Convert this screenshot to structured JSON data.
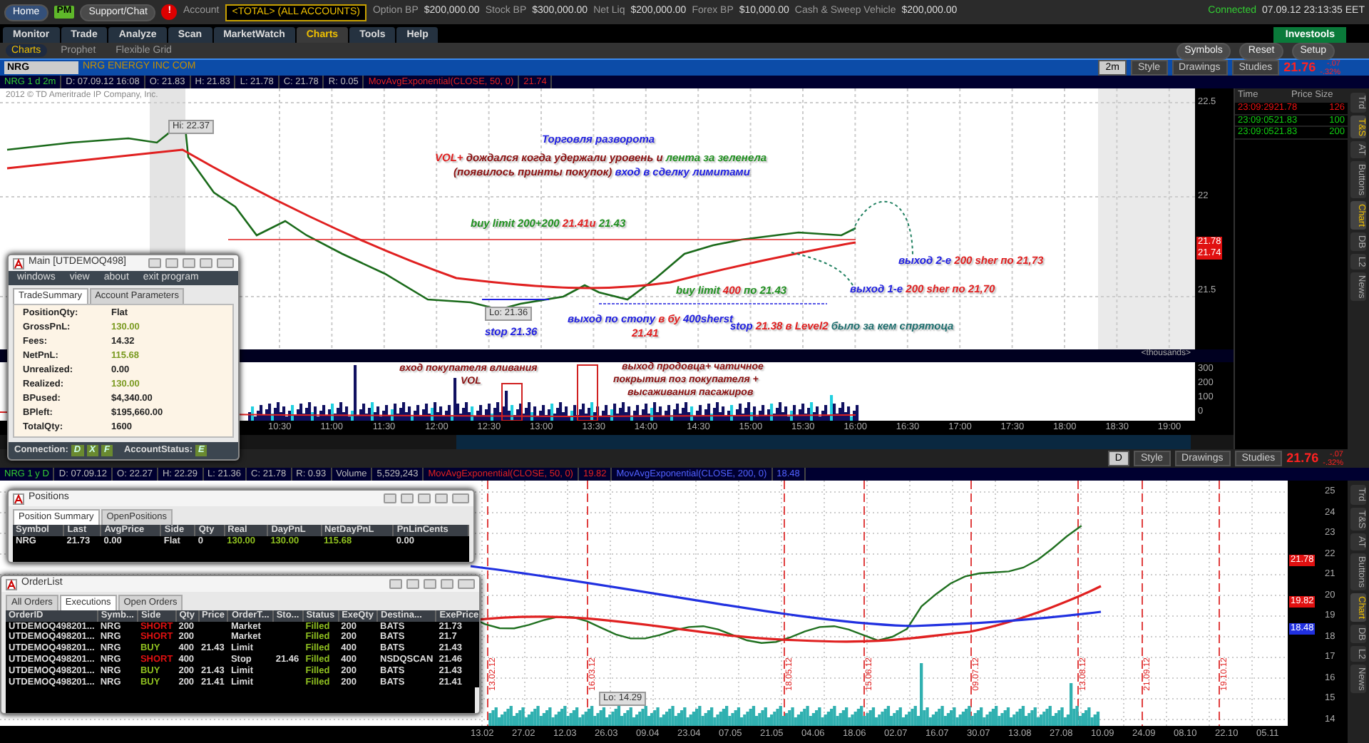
{
  "account_bar": {
    "home": "Home",
    "pm": "PM",
    "support": "Support/Chat",
    "alert": "!",
    "account_label": "Account",
    "account": "<TOTAL> (ALL ACCOUNTS)",
    "balances": [
      {
        "label": "Option BP",
        "value": "$200,000.00"
      },
      {
        "label": "Stock BP",
        "value": "$300,000.00"
      },
      {
        "label": "Net Liq",
        "value": "$200,000.00"
      },
      {
        "label": "Forex BP",
        "value": "$10,000.00"
      },
      {
        "label": "Cash & Sweep Vehicle",
        "value": "$200,000.00"
      }
    ],
    "status": "Connected",
    "datetime": "07.09.12 23:13:35 EET"
  },
  "main_tabs": [
    {
      "label": "Monitor",
      "selected": false
    },
    {
      "label": "Trade",
      "selected": false
    },
    {
      "label": "Analyze",
      "selected": false
    },
    {
      "label": "Scan",
      "selected": false
    },
    {
      "label": "MarketWatch",
      "selected": false
    },
    {
      "label": "Charts",
      "selected": true
    },
    {
      "label": "Tools",
      "selected": false
    },
    {
      "label": "Help",
      "selected": false
    }
  ],
  "investools": "Investools",
  "sub_tabs": [
    {
      "label": "Charts",
      "selected": true
    },
    {
      "label": "Prophet",
      "selected": false
    },
    {
      "label": "Flexible Grid",
      "selected": false
    }
  ],
  "toolbar_buttons": [
    "Symbols",
    "Reset",
    "Setup"
  ],
  "top_chart": {
    "symbol": "NRG",
    "company": "NRG ENERGY INC COM",
    "aggregation": "2m",
    "buttons": [
      "Style",
      "Drawings",
      "Studies"
    ],
    "last": "21.76",
    "change": "-.07",
    "change_pct": "-.32%",
    "info": [
      {
        "text": "NRG 1 d 2m",
        "kind": "title"
      },
      {
        "text": "D: 07.09.12 16:08",
        "kind": "plain"
      },
      {
        "text": "O: 21.83",
        "kind": "plain"
      },
      {
        "text": "H: 21.83",
        "kind": "plain"
      },
      {
        "text": "L: 21.78",
        "kind": "plain"
      },
      {
        "text": "C: 21.78",
        "kind": "plain"
      },
      {
        "text": "R: 0.05",
        "kind": "plain"
      },
      {
        "text": "MovAvgExponential(CLOSE, 50, 0)",
        "kind": "study"
      },
      {
        "text": "21.74",
        "kind": "study"
      }
    ],
    "copyright": "2012 © TD Ameritrade IP Company, Inc.",
    "high_label": "Hi: 22.37",
    "low_label": "Lo: 21.36",
    "price_axis": [
      "22.5",
      "22",
      "21.5"
    ],
    "price_tags": [
      "21.78",
      "21.74"
    ],
    "volume_unit": "<thousands>",
    "volume_axis": [
      "300",
      "200",
      "100",
      "0"
    ],
    "time_axis": [
      "10:30",
      "11:00",
      "11:30",
      "12:00",
      "12:30",
      "13:00",
      "13:30",
      "14:00",
      "14:30",
      "15:00",
      "15:30",
      "16:00",
      "16:30",
      "17:00",
      "17:30",
      "18:00",
      "18:30",
      "19:00"
    ],
    "annotations": [
      {
        "parts": [
          {
            "text": "Торговля разворота",
            "color": "#2020e0"
          }
        ]
      },
      {
        "parts": [
          {
            "text": "VOL+ ",
            "color": "#e02020"
          },
          {
            "text": "дождался когда  удержали уровень и ",
            "color": "#8a1010"
          },
          {
            "text": "лента за зеленела",
            "color": "#209020"
          }
        ]
      },
      {
        "parts": [
          {
            "text": "(появилось принты покупок) ",
            "color": "#8a1010"
          },
          {
            "text": "вход в сделку лимитами",
            "color": "#2020e0"
          }
        ]
      },
      {
        "parts": [
          {
            "text": "buy limit 200+200 ",
            "color": "#209020"
          },
          {
            "text": "21.41и ",
            "color": "#e02020"
          },
          {
            "text": "21.43",
            "color": "#209020"
          }
        ]
      },
      {
        "parts": [
          {
            "text": "stop 21.36",
            "color": "#2020e0"
          }
        ]
      },
      {
        "parts": [
          {
            "text": "выход по стопу ",
            "color": "#2020e0"
          },
          {
            "text": "в бу ",
            "color": "#e02020"
          },
          {
            "text": "400sherst",
            "color": "#2020e0"
          }
        ]
      },
      {
        "parts": [
          {
            "text": "21.41",
            "color": "#e02020"
          }
        ]
      },
      {
        "parts": [
          {
            "text": "buy limit ",
            "color": "#209020"
          },
          {
            "text": "400 ",
            "color": "#e02020"
          },
          {
            "text": "по 21.43",
            "color": "#209020"
          }
        ]
      },
      {
        "parts": [
          {
            "text": "stop ",
            "color": "#2020e0"
          },
          {
            "text": "21.38 в Level2 ",
            "color": "#e02020"
          },
          {
            "text": "было за кем спрятоца",
            "color": "#207070"
          }
        ]
      },
      {
        "parts": [
          {
            "text": "выход 1-е ",
            "color": "#2020e0"
          },
          {
            "text": "200 sher по 21,70",
            "color": "#e02020"
          }
        ]
      },
      {
        "parts": [
          {
            "text": "выход 2-е ",
            "color": "#2020e0"
          },
          {
            "text": "200 sher по 21,73",
            "color": "#e02020"
          }
        ]
      }
    ],
    "volume_annotations": [
      {
        "parts": [
          {
            "text": "вход покупателя вливания",
            "color": "#8a1010"
          }
        ]
      },
      {
        "parts": [
          {
            "text": "VOL",
            "color": "#8a1010"
          }
        ]
      },
      {
        "parts": [
          {
            "text": "выход продовца+ чатичное",
            "color": "#8a1010"
          }
        ]
      },
      {
        "parts": [
          {
            "text": "покрытия поз покупателя +",
            "color": "#8a1010"
          }
        ]
      },
      {
        "parts": [
          {
            "text": "высаживания пасажиров",
            "color": "#8a1010"
          }
        ]
      }
    ]
  },
  "time_sales": {
    "columns": [
      "Time",
      "Price Size"
    ],
    "rows": [
      {
        "time": "23:09:29",
        "price": "21.78",
        "size": "126",
        "kind": "down"
      },
      {
        "time": "23:09:05",
        "price": "21.83",
        "size": "100",
        "kind": "up"
      },
      {
        "time": "23:09:05",
        "price": "21.83",
        "size": "200",
        "kind": "up"
      }
    ]
  },
  "side_tabs_top": [
    {
      "label": "Trd",
      "selected": false
    },
    {
      "label": "T&S",
      "selected": true
    },
    {
      "label": "AT",
      "selected": false
    },
    {
      "label": "Buttons",
      "selected": false
    },
    {
      "label": "Chart",
      "selected": true
    },
    {
      "label": "DB",
      "selected": false
    },
    {
      "label": "L2",
      "selected": false
    },
    {
      "label": "News",
      "selected": false
    }
  ],
  "side_tabs_bottom": [
    {
      "label": "Trd",
      "selected": false
    },
    {
      "label": "T&S",
      "selected": false
    },
    {
      "label": "AT",
      "selected": false
    },
    {
      "label": "Buttons",
      "selected": false
    },
    {
      "label": "Chart",
      "selected": true
    },
    {
      "label": "DB",
      "selected": false
    },
    {
      "label": "L2",
      "selected": false
    },
    {
      "label": "News",
      "selected": false
    }
  ],
  "bottom_chart": {
    "aggregation": "D",
    "buttons": [
      "Style",
      "Drawings",
      "Studies"
    ],
    "last": "21.76",
    "change": "-.07",
    "change_pct": "-.32%",
    "info": [
      {
        "text": "NRG 1 y D",
        "kind": "title"
      },
      {
        "text": "D: 07.09.12",
        "kind": "plain"
      },
      {
        "text": "O: 22.27",
        "kind": "plain"
      },
      {
        "text": "H: 22.29",
        "kind": "plain"
      },
      {
        "text": "L: 21.36",
        "kind": "plain"
      },
      {
        "text": "C: 21.78",
        "kind": "plain"
      },
      {
        "text": "R: 0.93",
        "kind": "plain"
      },
      {
        "text": "Volume",
        "kind": "plain"
      },
      {
        "text": "5,529,243",
        "kind": "plain"
      },
      {
        "text": "MovAvgExponential(CLOSE, 50, 0)",
        "kind": "study"
      },
      {
        "text": "19.82",
        "kind": "study"
      },
      {
        "text": "MovAvgExponential(CLOSE, 200, 0)",
        "kind": "study2"
      },
      {
        "text": "18.48",
        "kind": "study2"
      }
    ],
    "price_axis": [
      "25",
      "24",
      "23",
      "22",
      "21",
      "20",
      "19",
      "18",
      "17",
      "16",
      "15",
      "14"
    ],
    "price_tags": [
      {
        "text": "21.78",
        "color": "#e01010"
      },
      {
        "text": "19.82",
        "color": "#e01010"
      },
      {
        "text": "18.48",
        "color": "#2030e0"
      }
    ],
    "low_label": "Lo: 14.29",
    "event_dates": [
      "13.02.12",
      "16.03.12",
      "18.05.12",
      "15.06.12",
      "09.07.12",
      "13.08.12",
      "21.09.12",
      "19.10.12"
    ],
    "date_axis": [
      "13.02",
      "27.02",
      "12.03",
      "26.03",
      "09.04",
      "23.04",
      "07.05",
      "21.05",
      "04.06",
      "18.06",
      "02.07",
      "16.07",
      "30.07",
      "13.08",
      "27.08",
      "10.09",
      "24.09",
      "08.10",
      "22.10",
      "05.11"
    ]
  },
  "main_window": {
    "title": "Main [UTDEMOQ498]",
    "menu": [
      "windows",
      "view",
      "about",
      "exit program"
    ],
    "tabs": [
      {
        "label": "TradeSummary",
        "selected": true
      },
      {
        "label": "Account Parameters",
        "selected": false
      }
    ],
    "fields": [
      {
        "label": "PositionQty:",
        "value": "Flat",
        "kind": "plain"
      },
      {
        "label": "GrossPnL:",
        "value": "130.00",
        "kind": "gain"
      },
      {
        "label": "Fees:",
        "value": "14.32",
        "kind": "plain"
      },
      {
        "label": "NetPnL:",
        "value": "115.68",
        "kind": "gain"
      },
      {
        "label": "Unrealized:",
        "value": "0.00",
        "kind": "plain"
      },
      {
        "label": "Realized:",
        "value": "130.00",
        "kind": "gain"
      },
      {
        "label": "BPused:",
        "value": "$4,340.00",
        "kind": "plain"
      },
      {
        "label": "BPleft:",
        "value": "$195,660.00",
        "kind": "plain"
      },
      {
        "label": "TotalQty:",
        "value": "1600",
        "kind": "plain"
      }
    ],
    "connection_label": "Connection:",
    "connection_flags": [
      "D",
      "X",
      "F"
    ],
    "account_status_label": "AccountStatus:",
    "account_status_flag": "E"
  },
  "positions_window": {
    "title": "Positions",
    "tabs": [
      {
        "label": "Position Summary",
        "selected": true
      },
      {
        "label": "OpenPositions",
        "selected": false
      }
    ],
    "columns": [
      "Symbol",
      "Last",
      "AvgPrice",
      "Side",
      "Qty",
      "Real",
      "DayPnL",
      "NetDayPnL",
      "PnLinCents"
    ],
    "rows": [
      {
        "cells": [
          "NRG",
          "21.73",
          "0.00",
          "Flat",
          "0",
          "130.00",
          "130.00",
          "115.68",
          "0.00"
        ]
      }
    ]
  },
  "orderlist_window": {
    "title": "OrderList",
    "tabs": [
      {
        "label": "All Orders",
        "selected": false
      },
      {
        "label": "Executions",
        "selected": true
      },
      {
        "label": "Open Orders",
        "selected": false
      }
    ],
    "columns": [
      "OrderID",
      "Symb...",
      "Side",
      "Qty",
      "Price",
      "OrderT...",
      "Sto...",
      "Status",
      "ExeQty",
      "Destina...",
      "ExePrice"
    ],
    "rows": [
      {
        "kind": "sell",
        "cells": [
          "UTDEMOQ498201...",
          "NRG",
          "SHORT",
          "200",
          "",
          "Market",
          "",
          "Filled",
          "200",
          "BATS",
          "21.73"
        ]
      },
      {
        "kind": "sell",
        "cells": [
          "UTDEMOQ498201...",
          "NRG",
          "SHORT",
          "200",
          "",
          "Market",
          "",
          "Filled",
          "200",
          "BATS",
          "21.7"
        ]
      },
      {
        "kind": "buy",
        "cells": [
          "UTDEMOQ498201...",
          "NRG",
          "BUY",
          "400",
          "21.43",
          "Limit",
          "",
          "Filled",
          "400",
          "BATS",
          "21.43"
        ]
      },
      {
        "kind": "sell",
        "cells": [
          "UTDEMOQ498201...",
          "NRG",
          "SHORT",
          "400",
          "",
          "Stop",
          "21.46",
          "Filled",
          "400",
          "NSDQSCAN",
          "21.46"
        ]
      },
      {
        "kind": "buy",
        "cells": [
          "UTDEMOQ498201...",
          "NRG",
          "BUY",
          "200",
          "21.43",
          "Limit",
          "",
          "Filled",
          "200",
          "BATS",
          "21.43"
        ]
      },
      {
        "kind": "buy",
        "cells": [
          "UTDEMOQ498201...",
          "NRG",
          "BUY",
          "200",
          "21.41",
          "Limit",
          "",
          "Filled",
          "200",
          "BATS",
          "21.41"
        ]
      }
    ]
  }
}
